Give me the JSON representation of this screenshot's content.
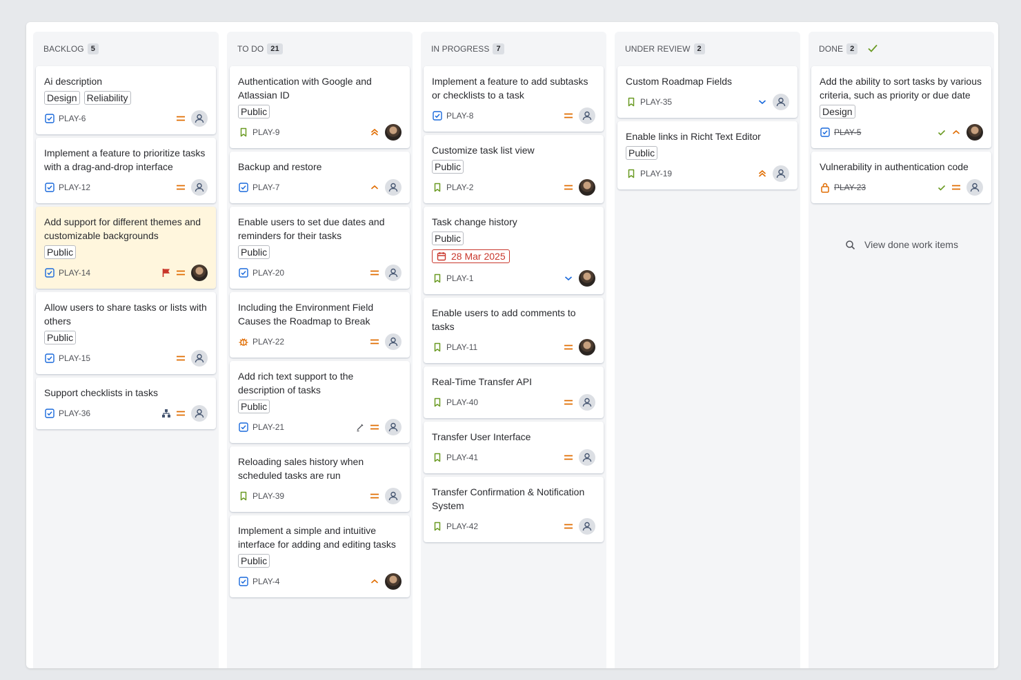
{
  "colors": {
    "accent_blue": "#1868db",
    "priority_orange": "#e06c00",
    "story_green": "#6a9a23",
    "bug_orange": "#e06c00",
    "danger_red": "#c9372c",
    "highlight": "#fff6dd"
  },
  "columns": [
    {
      "title": "BACKLOG",
      "count": "5",
      "cards": [
        {
          "title": "Ai description",
          "labels": [
            "Design",
            "Reliability"
          ],
          "type": "task-icon",
          "key": "PLAY-6",
          "priority": "medium-priority-icon",
          "assignee": "unassigned"
        },
        {
          "title": "Implement a feature to prioritize tasks with a drag-and-drop interface",
          "labels": [],
          "type": "task-icon",
          "key": "PLAY-12",
          "priority": "medium-priority-icon",
          "assignee": "unassigned"
        },
        {
          "title": "Add support for different themes and customizable backgrounds",
          "labels": [
            "Public"
          ],
          "type": "task-icon",
          "key": "PLAY-14",
          "flag": "flag-icon",
          "priority": "medium-priority-icon",
          "assignee": "photo",
          "highlight": true
        },
        {
          "title": "Allow users to share tasks or lists with others",
          "labels": [
            "Public"
          ],
          "type": "task-icon",
          "key": "PLAY-15",
          "priority": "medium-priority-icon",
          "assignee": "unassigned"
        },
        {
          "title": "Support checklists in tasks",
          "labels": [],
          "type": "task-icon",
          "key": "PLAY-36",
          "extra": "hierarchy-icon",
          "priority": "medium-priority-icon",
          "assignee": "unassigned"
        }
      ]
    },
    {
      "title": "TO DO",
      "count": "21",
      "cards": [
        {
          "title": "Authentication with Google and Atlassian ID",
          "labels": [
            "Public"
          ],
          "type": "story-icon",
          "key": "PLAY-9",
          "priority": "highest-priority-icon",
          "assignee": "photo"
        },
        {
          "title": "Backup and restore",
          "labels": [],
          "type": "task-icon",
          "key": "PLAY-7",
          "priority": "high-priority-icon",
          "assignee": "unassigned"
        },
        {
          "title": "Enable users to set due dates and reminders for their tasks",
          "labels": [
            "Public"
          ],
          "type": "task-icon",
          "key": "PLAY-20",
          "priority": "medium-priority-icon",
          "assignee": "unassigned"
        },
        {
          "title": "Including the Environment Field Causes the Roadmap to Break",
          "labels": [],
          "type": "bug-icon",
          "key": "PLAY-22",
          "priority": "medium-priority-icon",
          "assignee": "unassigned"
        },
        {
          "title": "Add rich text support to the description of tasks",
          "labels": [
            "Public"
          ],
          "type": "task-icon",
          "key": "PLAY-21",
          "extra": "pencil-icon",
          "priority": "medium-priority-icon",
          "assignee": "unassigned"
        },
        {
          "title": "Reloading sales history when scheduled tasks are run",
          "labels": [],
          "type": "story-icon",
          "key": "PLAY-39",
          "priority": "medium-priority-icon",
          "assignee": "unassigned"
        },
        {
          "title": "Implement a simple and intuitive interface for adding and editing tasks",
          "labels": [
            "Public"
          ],
          "type": "task-icon",
          "key": "PLAY-4",
          "priority": "high-priority-icon",
          "assignee": "photo"
        }
      ]
    },
    {
      "title": "IN PROGRESS",
      "count": "7",
      "cards": [
        {
          "title": "Implement a feature to add subtasks or checklists to a task",
          "labels": [],
          "type": "task-icon",
          "key": "PLAY-8",
          "priority": "medium-priority-icon",
          "assignee": "unassigned"
        },
        {
          "title": "Customize task list view",
          "labels": [
            "Public"
          ],
          "type": "story-icon",
          "key": "PLAY-2",
          "priority": "medium-priority-icon",
          "assignee": "photo"
        },
        {
          "title": "Task change history",
          "labels": [
            "Public"
          ],
          "due": "28 Mar 2025",
          "type": "story-icon",
          "key": "PLAY-1",
          "priority": "low-priority-icon",
          "assignee": "photo"
        },
        {
          "title": "Enable users to add comments to tasks",
          "labels": [],
          "type": "story-icon",
          "key": "PLAY-11",
          "priority": "medium-priority-icon",
          "assignee": "photo"
        },
        {
          "title": "Real-Time Transfer API",
          "labels": [],
          "type": "story-icon",
          "key": "PLAY-40",
          "priority": "medium-priority-icon",
          "assignee": "unassigned"
        },
        {
          "title": "Transfer User Interface",
          "labels": [],
          "type": "story-icon",
          "key": "PLAY-41",
          "priority": "medium-priority-icon",
          "assignee": "unassigned"
        },
        {
          "title": "Transfer Confirmation & Notification System",
          "labels": [],
          "type": "story-icon",
          "key": "PLAY-42",
          "priority": "medium-priority-icon",
          "assignee": "unassigned"
        }
      ]
    },
    {
      "title": "UNDER REVIEW",
      "count": "2",
      "cards": [
        {
          "title": "Custom Roadmap Fields",
          "labels": [],
          "type": "story-icon",
          "key": "PLAY-35",
          "priority": "low-priority-icon",
          "assignee": "unassigned"
        },
        {
          "title": "Enable links in Richt Text Editor",
          "labels": [
            "Public"
          ],
          "type": "story-icon",
          "key": "PLAY-19",
          "priority": "highest-priority-icon",
          "assignee": "unassigned"
        }
      ]
    },
    {
      "title": "DONE",
      "count": "2",
      "done": true,
      "cards": [
        {
          "title": "Add the ability to sort tasks by various criteria, such as priority or due date",
          "labels": [
            "Design"
          ],
          "type": "task-icon",
          "key": "PLAY-5",
          "keyDone": true,
          "extra": "done-check-icon",
          "priority": "high-priority-icon",
          "assignee": "photo"
        },
        {
          "title": "Vulnerability in authentication code",
          "labels": [],
          "type": "lock-icon",
          "key": "PLAY-23",
          "keyDone": true,
          "extra": "done-check-icon",
          "priority": "medium-priority-icon",
          "assignee": "unassigned"
        }
      ],
      "view_done_label": "View done work items"
    }
  ]
}
